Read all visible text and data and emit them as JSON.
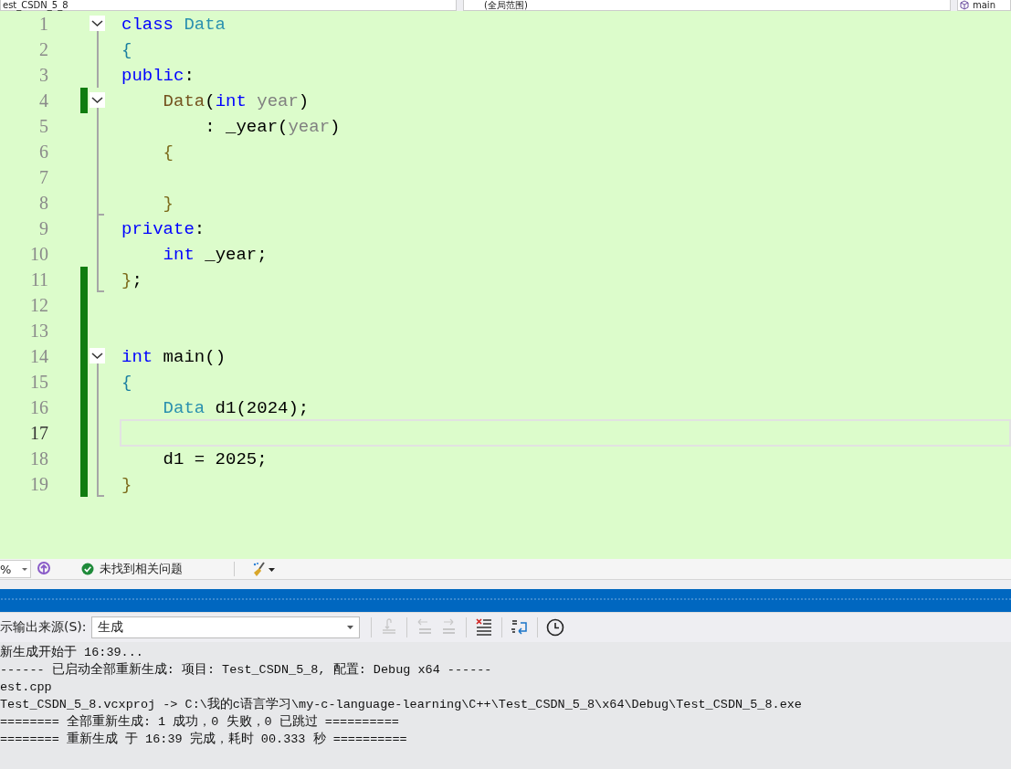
{
  "top_bar": {
    "project": "est_CSDN_5_8",
    "scope": "(全局范围)",
    "member": "main"
  },
  "editor": {
    "lines": [
      {
        "number": "1",
        "changed": false,
        "fold_start": true,
        "fold_guide": false,
        "fold_end": false,
        "current": false,
        "tokens": [
          {
            "text": "class",
            "kind": "keyword"
          },
          {
            "text": " Data",
            "kind": "type"
          }
        ]
      },
      {
        "number": "2",
        "changed": false,
        "fold_start": false,
        "fold_guide": true,
        "fold_end": false,
        "current": false,
        "tokens": [
          {
            "text": "{",
            "kind": "brace_a"
          }
        ]
      },
      {
        "number": "3",
        "changed": false,
        "fold_start": false,
        "fold_guide": true,
        "fold_end": false,
        "current": false,
        "tokens": [
          {
            "text": "public",
            "kind": "keyword"
          },
          {
            "text": ":",
            "kind": "plain"
          }
        ]
      },
      {
        "number": "4",
        "changed": true,
        "fold_start": true,
        "fold_guide": false,
        "fold_end": false,
        "current": false,
        "tokens": [
          {
            "text": "    Data",
            "kind": "function"
          },
          {
            "text": "(",
            "kind": "plain"
          },
          {
            "text": "int",
            "kind": "keyword"
          },
          {
            "text": " year",
            "kind": "param"
          },
          {
            "text": ")",
            "kind": "plain"
          }
        ]
      },
      {
        "number": "5",
        "changed": false,
        "fold_start": false,
        "fold_guide": true,
        "fold_end": false,
        "current": false,
        "tokens": [
          {
            "text": "        : _year",
            "kind": "plain"
          },
          {
            "text": "(",
            "kind": "plain"
          },
          {
            "text": "year",
            "kind": "param"
          },
          {
            "text": ")",
            "kind": "plain"
          }
        ]
      },
      {
        "number": "6",
        "changed": false,
        "fold_start": false,
        "fold_guide": true,
        "fold_end": false,
        "current": false,
        "tokens": [
          {
            "text": "    {",
            "kind": "brace_b"
          }
        ]
      },
      {
        "number": "7",
        "changed": false,
        "fold_start": false,
        "fold_guide": true,
        "fold_end": false,
        "current": false
      },
      {
        "number": "8",
        "changed": false,
        "fold_start": false,
        "fold_guide": true,
        "fold_end": true,
        "current": false,
        "tokens": [
          {
            "text": "    }",
            "kind": "brace_b"
          }
        ]
      },
      {
        "number": "9",
        "changed": false,
        "fold_start": false,
        "fold_guide": true,
        "fold_end": false,
        "current": false,
        "tokens": [
          {
            "text": "private",
            "kind": "keyword"
          },
          {
            "text": ":",
            "kind": "plain"
          }
        ]
      },
      {
        "number": "10",
        "changed": false,
        "fold_start": false,
        "fold_guide": true,
        "fold_end": false,
        "current": false,
        "tokens": [
          {
            "text": "    int",
            "kind": "keyword"
          },
          {
            "text": " _year;",
            "kind": "plain"
          }
        ]
      },
      {
        "number": "11",
        "changed": true,
        "fold_start": false,
        "fold_guide": true,
        "fold_end": true,
        "current": false,
        "tokens": [
          {
            "text": "}",
            "kind": "brace_b"
          },
          {
            "text": ";",
            "kind": "plain"
          }
        ]
      },
      {
        "number": "12",
        "changed": true,
        "fold_start": false,
        "fold_guide": false,
        "fold_end": false,
        "current": false
      },
      {
        "number": "13",
        "changed": true,
        "fold_start": false,
        "fold_guide": false,
        "fold_end": false,
        "current": false
      },
      {
        "number": "14",
        "changed": true,
        "fold_start": true,
        "fold_guide": false,
        "fold_end": false,
        "current": false,
        "tokens": [
          {
            "text": "int",
            "kind": "keyword"
          },
          {
            "text": " main()",
            "kind": "plain"
          }
        ]
      },
      {
        "number": "15",
        "changed": true,
        "fold_start": false,
        "fold_guide": true,
        "fold_end": false,
        "current": false,
        "tokens": [
          {
            "text": "{",
            "kind": "brace_a"
          }
        ]
      },
      {
        "number": "16",
        "changed": true,
        "fold_start": false,
        "fold_guide": true,
        "fold_end": false,
        "current": false,
        "tokens": [
          {
            "text": "    Data",
            "kind": "type"
          },
          {
            "text": " d1(2024);",
            "kind": "plain"
          }
        ]
      },
      {
        "number": "17",
        "changed": true,
        "fold_start": false,
        "fold_guide": true,
        "fold_end": false,
        "current": true
      },
      {
        "number": "18",
        "changed": true,
        "fold_start": false,
        "fold_guide": true,
        "fold_end": false,
        "current": false,
        "tokens": [
          {
            "text": "    d1 = 2025;",
            "kind": "plain"
          }
        ]
      },
      {
        "number": "19",
        "changed": true,
        "fold_start": false,
        "fold_guide": true,
        "fold_end": true,
        "current": false,
        "tokens": [
          {
            "text": "}",
            "kind": "brace_b"
          }
        ]
      }
    ]
  },
  "status_bar": {
    "zoom": "%",
    "issues": "未找到相关问题"
  },
  "output": {
    "source_label": "示输出来源(S):",
    "source": "生成",
    "buttons": [
      {
        "kind": "goto",
        "disabled": true
      },
      {
        "kind": "prev",
        "disabled": true
      },
      {
        "kind": "next",
        "disabled": true
      },
      {
        "kind": "clear",
        "disabled": false
      },
      {
        "kind": "wrap",
        "disabled": false
      },
      {
        "kind": "clock",
        "disabled": false
      }
    ],
    "lines": [
      "新生成开始于 16:39...",
      "------ 已启动全部重新生成: 项目: Test_CSDN_5_8, 配置: Debug x64 ------",
      "est.cpp",
      "Test_CSDN_5_8.vcxproj -> C:\\我的c语言学习\\my-c-language-learning\\C++\\Test_CSDN_5_8\\x64\\Debug\\Test_CSDN_5_8.exe",
      "======== 全部重新生成: 1 成功，0 失败，0 已跳过 ==========",
      "======== 重新生成 于 16:39 完成，耗时 00.333 秒 =========="
    ]
  }
}
